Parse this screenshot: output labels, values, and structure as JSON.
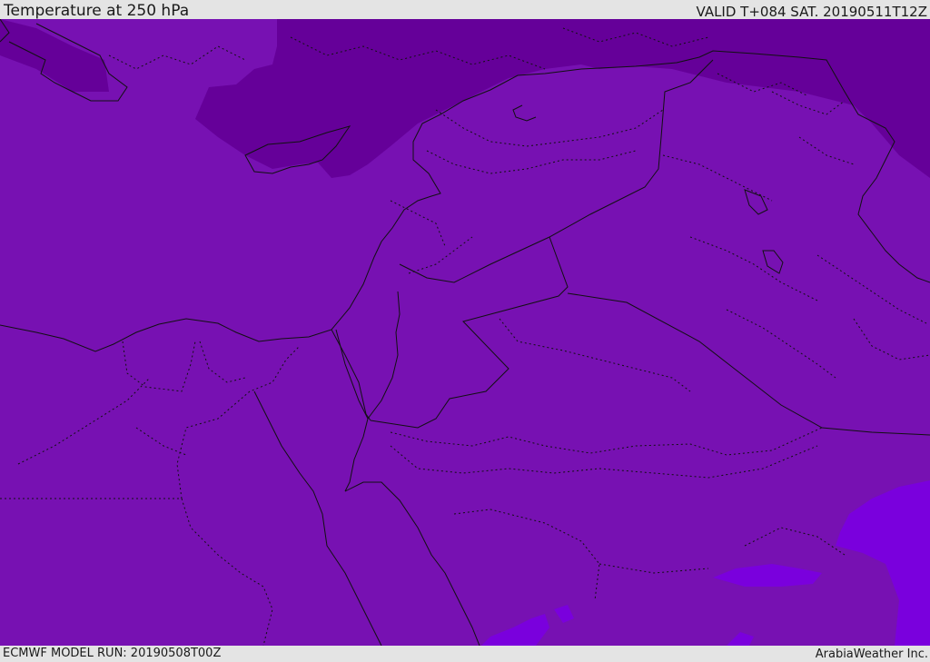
{
  "header": {
    "title": "Temperature at 250 hPa",
    "valid": "VALID T+084 SAT. 20190511T12Z"
  },
  "footer": {
    "model_run": "ECMWF MODEL RUN: 20190508T00Z",
    "credit": "ArabiaWeather Inc."
  },
  "colors": {
    "base_field": "#7711b2",
    "cold_band": "#650099",
    "warm_band": "#7a00dd",
    "borders": "#111111",
    "frame": "#e4e4e4"
  }
}
